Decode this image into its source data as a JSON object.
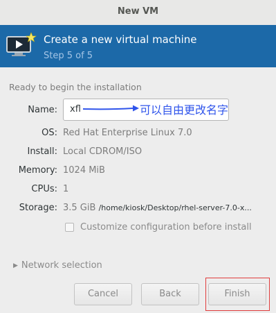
{
  "window": {
    "title": "New VM"
  },
  "banner": {
    "heading": "Create a new virtual machine",
    "step": "Step 5 of 5",
    "icon": "vm-wizard-icon"
  },
  "section_label": "Ready to begin the installation",
  "fields": {
    "name": {
      "label": "Name:",
      "value": "xfl"
    },
    "os": {
      "label": "OS:",
      "value": "Red Hat Enterprise Linux 7.0"
    },
    "install": {
      "label": "Install:",
      "value": "Local CDROM/ISO"
    },
    "memory": {
      "label": "Memory:",
      "value": "1024 MiB"
    },
    "cpus": {
      "label": "CPUs:",
      "value": "1"
    },
    "storage": {
      "label": "Storage:",
      "size": "3.5 GiB",
      "path": "/home/kiosk/Desktop/rhel-server-7.0-x..."
    }
  },
  "annotation": {
    "text": "可以自由更改名字",
    "color": "#2f54eb"
  },
  "customize": {
    "label": "Customize configuration before install",
    "checked": false
  },
  "network": {
    "label": "Network selection",
    "expanded": false
  },
  "buttons": {
    "cancel": "Cancel",
    "back": "Back",
    "finish": "Finish"
  },
  "colors": {
    "banner": "#1c69a8",
    "highlight": "#e03c3c"
  }
}
